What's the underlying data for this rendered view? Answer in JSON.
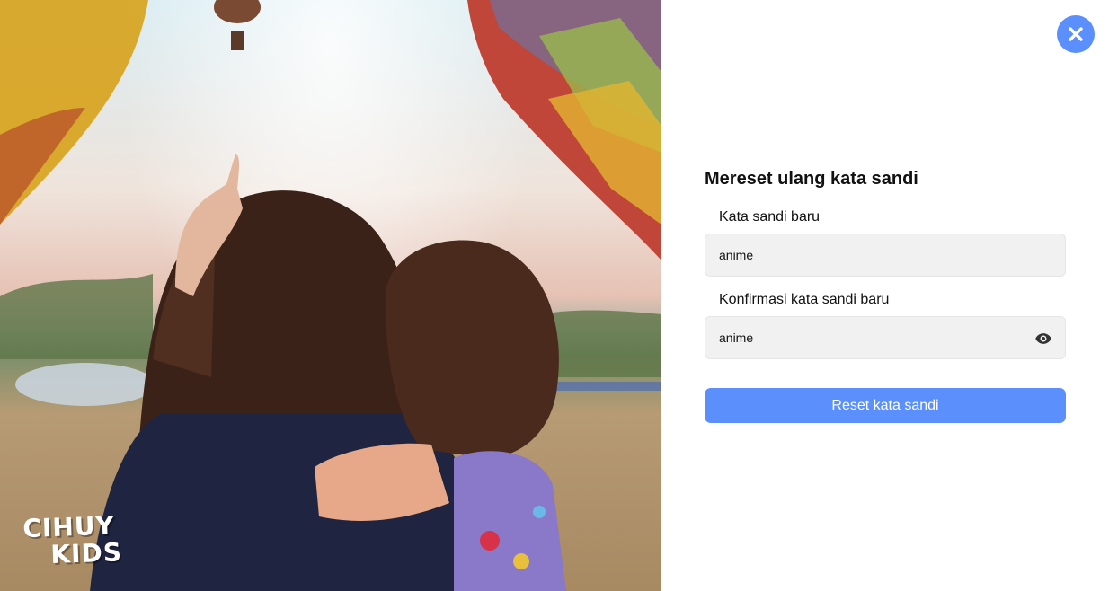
{
  "brand": {
    "line1": "CIHUY",
    "line2": "KIDS"
  },
  "close": {
    "icon": "close-icon"
  },
  "form": {
    "title": "Mereset ulang kata sandi",
    "new_password": {
      "label": "Kata sandi baru",
      "value": "anime"
    },
    "confirm_password": {
      "label": "Konfirmasi kata sandi baru",
      "value": "anime",
      "toggle_icon": "eye-icon"
    },
    "submit_label": "Reset kata sandi"
  },
  "colors": {
    "accent": "#5b8ffb",
    "field_bg": "#f1f1f1"
  }
}
